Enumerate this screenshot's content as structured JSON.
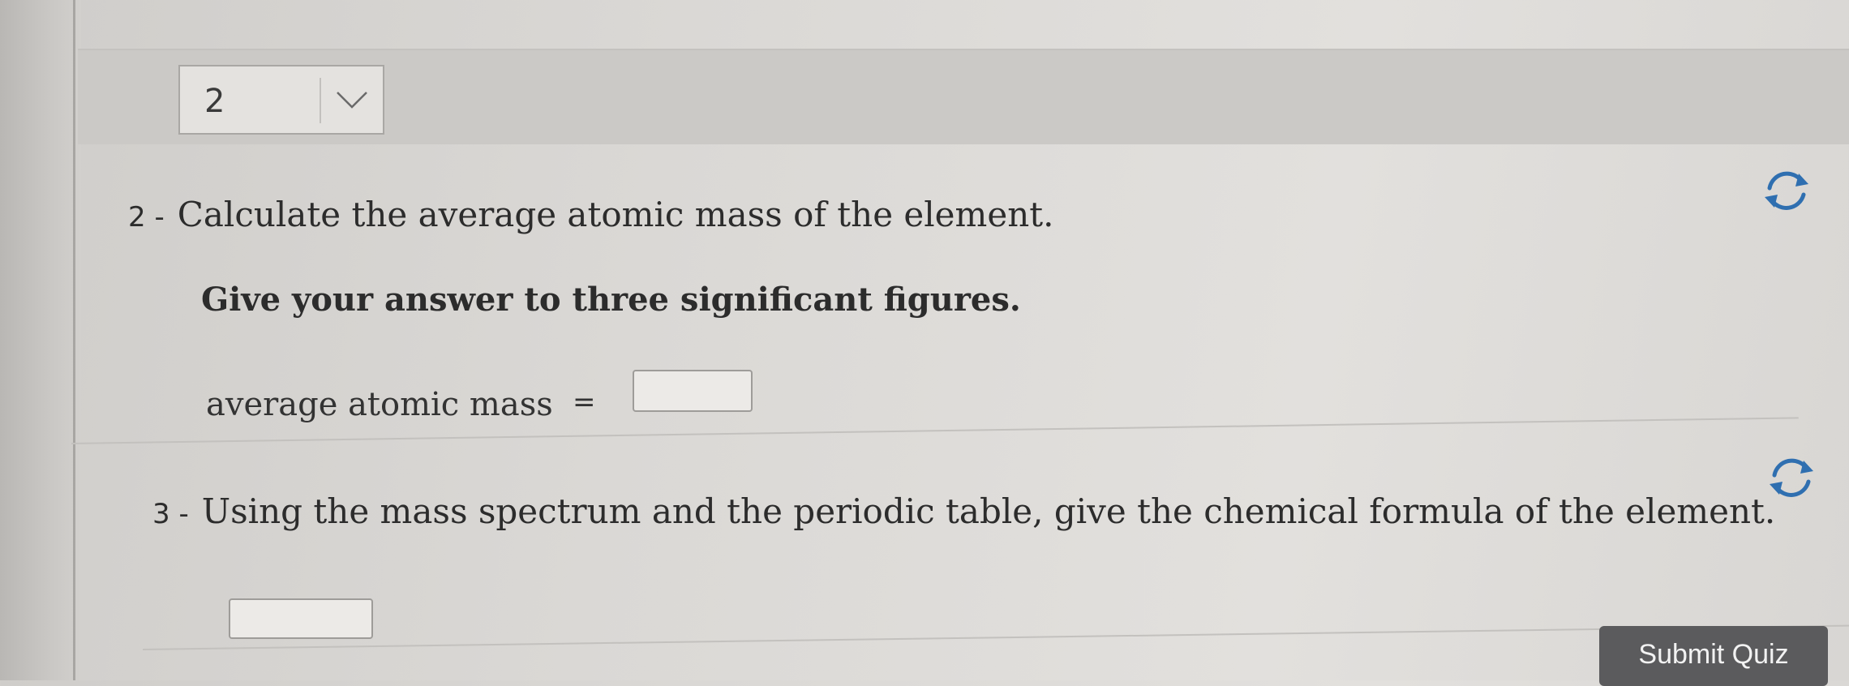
{
  "part_selector": {
    "selected": "2"
  },
  "questions": [
    {
      "number": "2 -",
      "prompt": "Calculate the average atomic mass of the element.",
      "instruction": "Give your answer to three significant figures.",
      "answer_label": "average atomic mass",
      "answer_equals": "=",
      "answer_value": ""
    },
    {
      "number": "3 -",
      "prompt": "Using the mass spectrum and the periodic table, give the chemical formula of the element.",
      "answer_value": ""
    }
  ],
  "icons": {
    "dropdown": "chevron-down-icon",
    "reset": "refresh-icon"
  },
  "submit": {
    "label": "Submit Quiz"
  },
  "colors": {
    "button_bg": "#5b5b5d",
    "button_text": "#f2f2f2",
    "icon": "#2f6fb0"
  }
}
